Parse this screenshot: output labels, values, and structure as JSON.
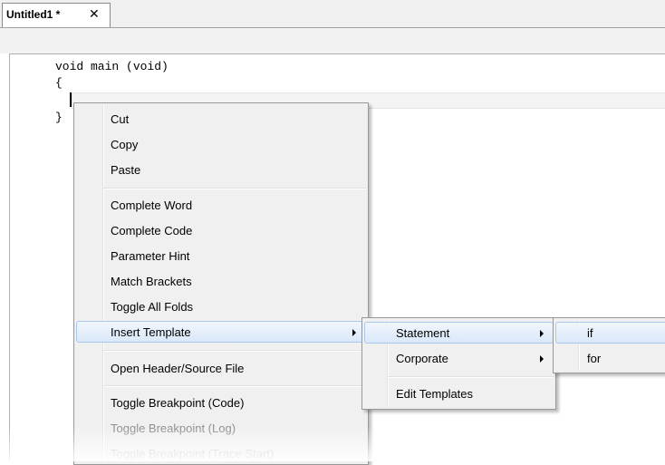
{
  "tab": {
    "title": "Untitled1 *",
    "close": "✕"
  },
  "code": {
    "line1": "void main (void)",
    "line2": "{",
    "line4": "}"
  },
  "context_menu": {
    "items": [
      {
        "label": "Cut"
      },
      {
        "label": "Copy"
      },
      {
        "label": "Paste"
      },
      {
        "label": "Complete Word"
      },
      {
        "label": "Complete Code"
      },
      {
        "label": "Parameter Hint"
      },
      {
        "label": "Match Brackets"
      },
      {
        "label": "Toggle All Folds"
      },
      {
        "label": "Insert Template"
      },
      {
        "label": "Open Header/Source File"
      },
      {
        "label": "Toggle Breakpoint (Code)"
      },
      {
        "label": "Toggle Breakpoint (Log)"
      },
      {
        "label": "Toggle Breakpoint (Trace Start)"
      }
    ]
  },
  "template_menu": {
    "items": [
      {
        "label": "Statement"
      },
      {
        "label": "Corporate"
      },
      {
        "label": "Edit Templates"
      }
    ]
  },
  "statement_menu": {
    "items": [
      {
        "label": "if"
      },
      {
        "label": "for"
      }
    ]
  },
  "colors": {
    "highlight": "#d9e8f9",
    "highlight_border": "#a8c8ee",
    "menu_bg": "#f0f0f0"
  }
}
